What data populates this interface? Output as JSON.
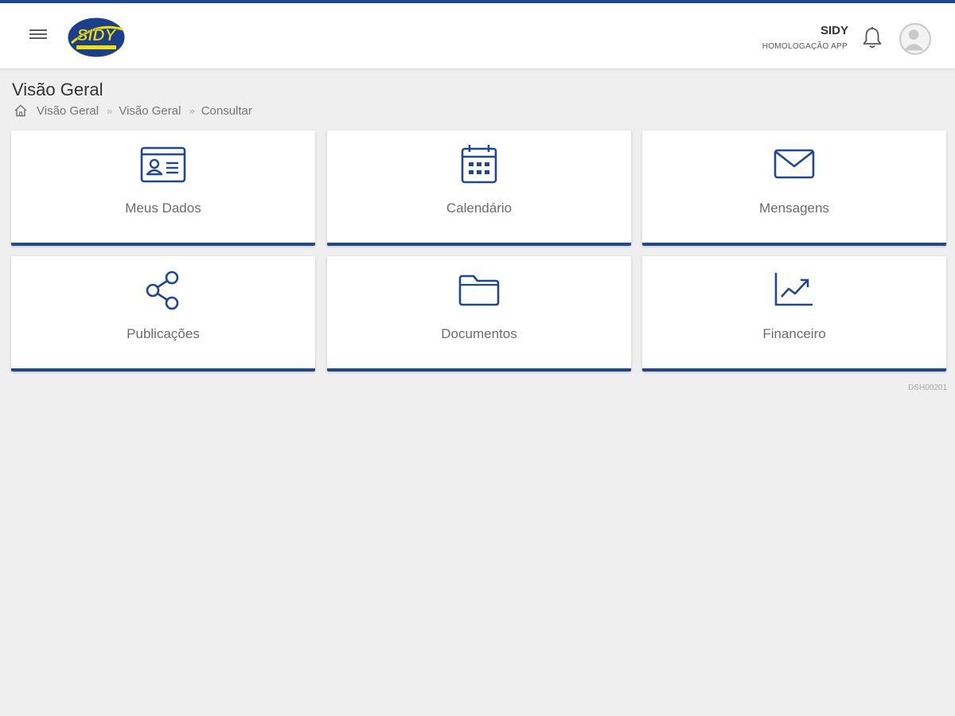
{
  "colors": {
    "accent": "#1f4796",
    "logo_blue": "#1b3f8c",
    "logo_yellow": "#f4e100",
    "background": "#efefef",
    "card": "#ffffff"
  },
  "header": {
    "logo_text": "SIDY",
    "user_name": "SIDY",
    "user_subtitle": "HOMOLOGAÇÃO APP",
    "icons": [
      "menu-icon",
      "bell-icon",
      "user-avatar-icon"
    ]
  },
  "page": {
    "title": "Visão Geral"
  },
  "breadcrumb": {
    "home_icon": "home-icon",
    "items": [
      "Visão Geral",
      "Visão Geral",
      "Consultar"
    ],
    "separator": "»"
  },
  "cards": [
    {
      "label": "Meus Dados",
      "icon": "id-card-icon"
    },
    {
      "label": "Calendário",
      "icon": "calendar-icon"
    },
    {
      "label": "Mensagens",
      "icon": "envelope-icon"
    },
    {
      "label": "Publicações",
      "icon": "share-icon"
    },
    {
      "label": "Documentos",
      "icon": "folder-icon"
    },
    {
      "label": "Financeiro",
      "icon": "trend-chart-icon"
    }
  ],
  "screen_code": "DSH00201"
}
